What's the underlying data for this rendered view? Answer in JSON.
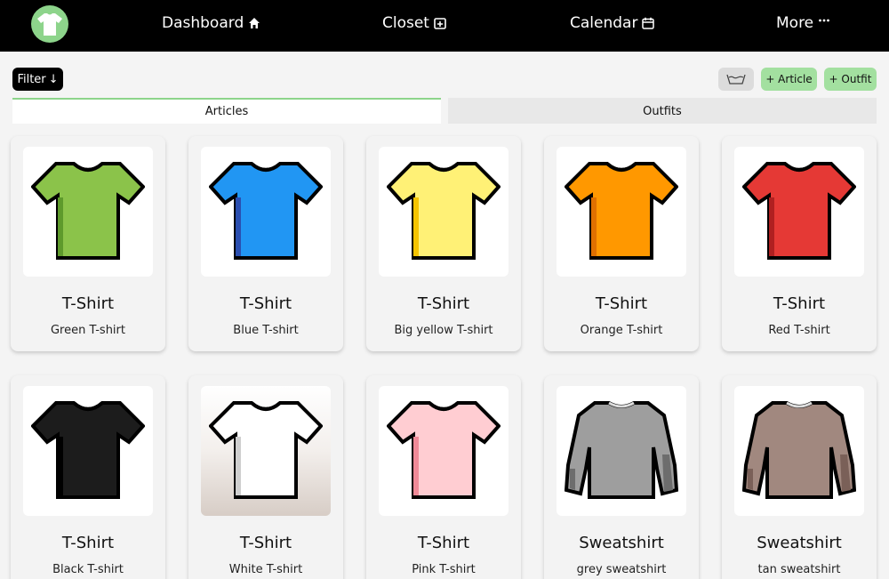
{
  "nav": {
    "logo_icon": "tshirt-icon",
    "dashboard": "Dashboard",
    "closet": "Closet",
    "calendar": "Calendar",
    "more": "More"
  },
  "toolbar": {
    "filter_label": "Filter",
    "wash_icon": "laundry-basin-icon",
    "add_article_label": "+ Article",
    "add_outfit_label": "+ Outfit"
  },
  "tabs": {
    "articles": "Articles",
    "outfits": "Outfits",
    "active": "Articles"
  },
  "colors": {
    "nav_bg": "#000000",
    "accent_green": "#a3e0a0",
    "logo_green": "#8dd48b"
  },
  "articles": [
    {
      "type": "T-Shirt",
      "name": "Green T-shirt",
      "color": "#8bc34a",
      "shade": "#5e9a2c",
      "kind": "tshirt"
    },
    {
      "type": "T-Shirt",
      "name": "Blue T-shirt",
      "color": "#2196f3",
      "shade": "#2a4fb0",
      "kind": "tshirt"
    },
    {
      "type": "T-Shirt",
      "name": "Big yellow T-shirt",
      "color": "#fff176",
      "shade": "#f5c400",
      "kind": "tshirt"
    },
    {
      "type": "T-Shirt",
      "name": "Orange T-shirt",
      "color": "#ff9800",
      "shade": "#e07000",
      "kind": "tshirt"
    },
    {
      "type": "T-Shirt",
      "name": "Red T-shirt",
      "color": "#e53935",
      "shade": "#b02020",
      "kind": "tshirt"
    },
    {
      "type": "T-Shirt",
      "name": "Black T-shirt",
      "color": "#1c1c1c",
      "shade": "#000000",
      "kind": "tshirt"
    },
    {
      "type": "T-Shirt",
      "name": "White T-shirt",
      "color": "#ffffff",
      "shade": "#cfcfcf",
      "kind": "tshirt"
    },
    {
      "type": "T-Shirt",
      "name": "Pink T-shirt",
      "color": "#ffcdd2",
      "shade": "#f08a98",
      "kind": "tshirt"
    },
    {
      "type": "Sweatshirt",
      "name": "grey sweatshirt",
      "color": "#9e9e9e",
      "shade": "#6d6d6d",
      "kind": "sweatshirt"
    },
    {
      "type": "Sweatshirt",
      "name": "tan sweatshirt",
      "color": "#a1887f",
      "shade": "#7a6058",
      "kind": "sweatshirt"
    }
  ]
}
